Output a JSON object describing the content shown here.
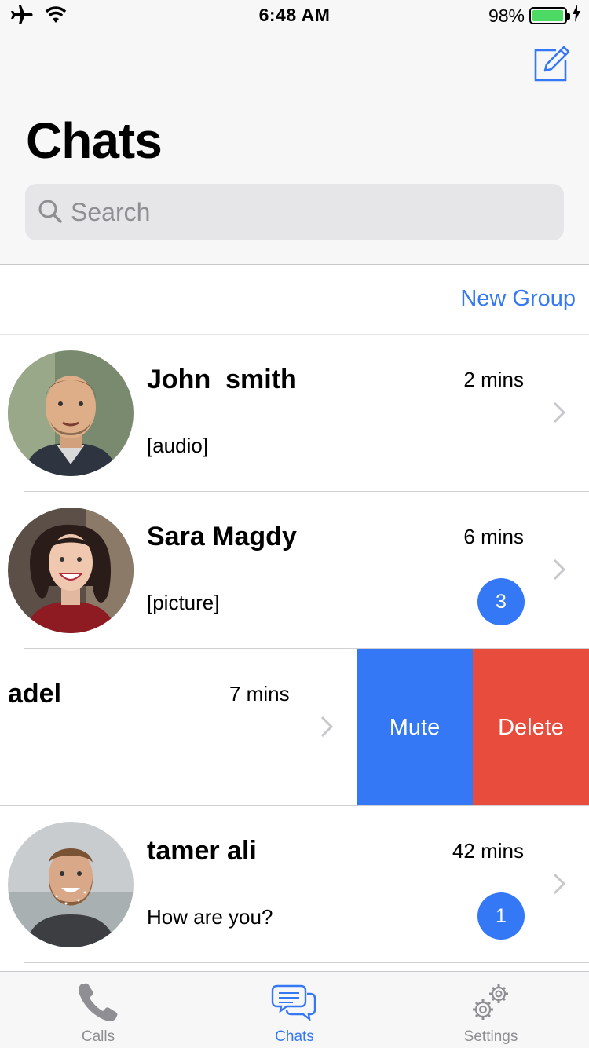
{
  "status_bar": {
    "time": "6:48 AM",
    "battery_percent": "98%",
    "battery_level": 0.98
  },
  "header": {
    "title": "Chats",
    "compose_icon": "compose-icon",
    "search": {
      "placeholder": "Search",
      "value": ""
    }
  },
  "new_group_label": "New Group",
  "chats": [
    {
      "name": "John  smith",
      "time": "2 mins",
      "preview": "[audio]",
      "badge": null
    },
    {
      "name": "Sara Magdy",
      "time": "6 mins",
      "preview": "[picture]",
      "badge": "3"
    },
    {
      "name": "adel",
      "time": "7 mins",
      "preview": "",
      "badge": null,
      "actions": {
        "mute": "Mute",
        "delete": "Delete"
      }
    },
    {
      "name": "tamer ali",
      "time": "42 mins",
      "preview": "How are you?",
      "badge": "1"
    }
  ],
  "tabs": [
    {
      "label": "Calls",
      "icon": "phone-icon",
      "active": false
    },
    {
      "label": "Chats",
      "icon": "chat-bubbles-icon",
      "active": true
    },
    {
      "label": "Settings",
      "icon": "gears-icon",
      "active": false
    }
  ],
  "colors": {
    "accent": "#3478f6",
    "delete": "#e84c3d",
    "battery": "#4cd964"
  }
}
